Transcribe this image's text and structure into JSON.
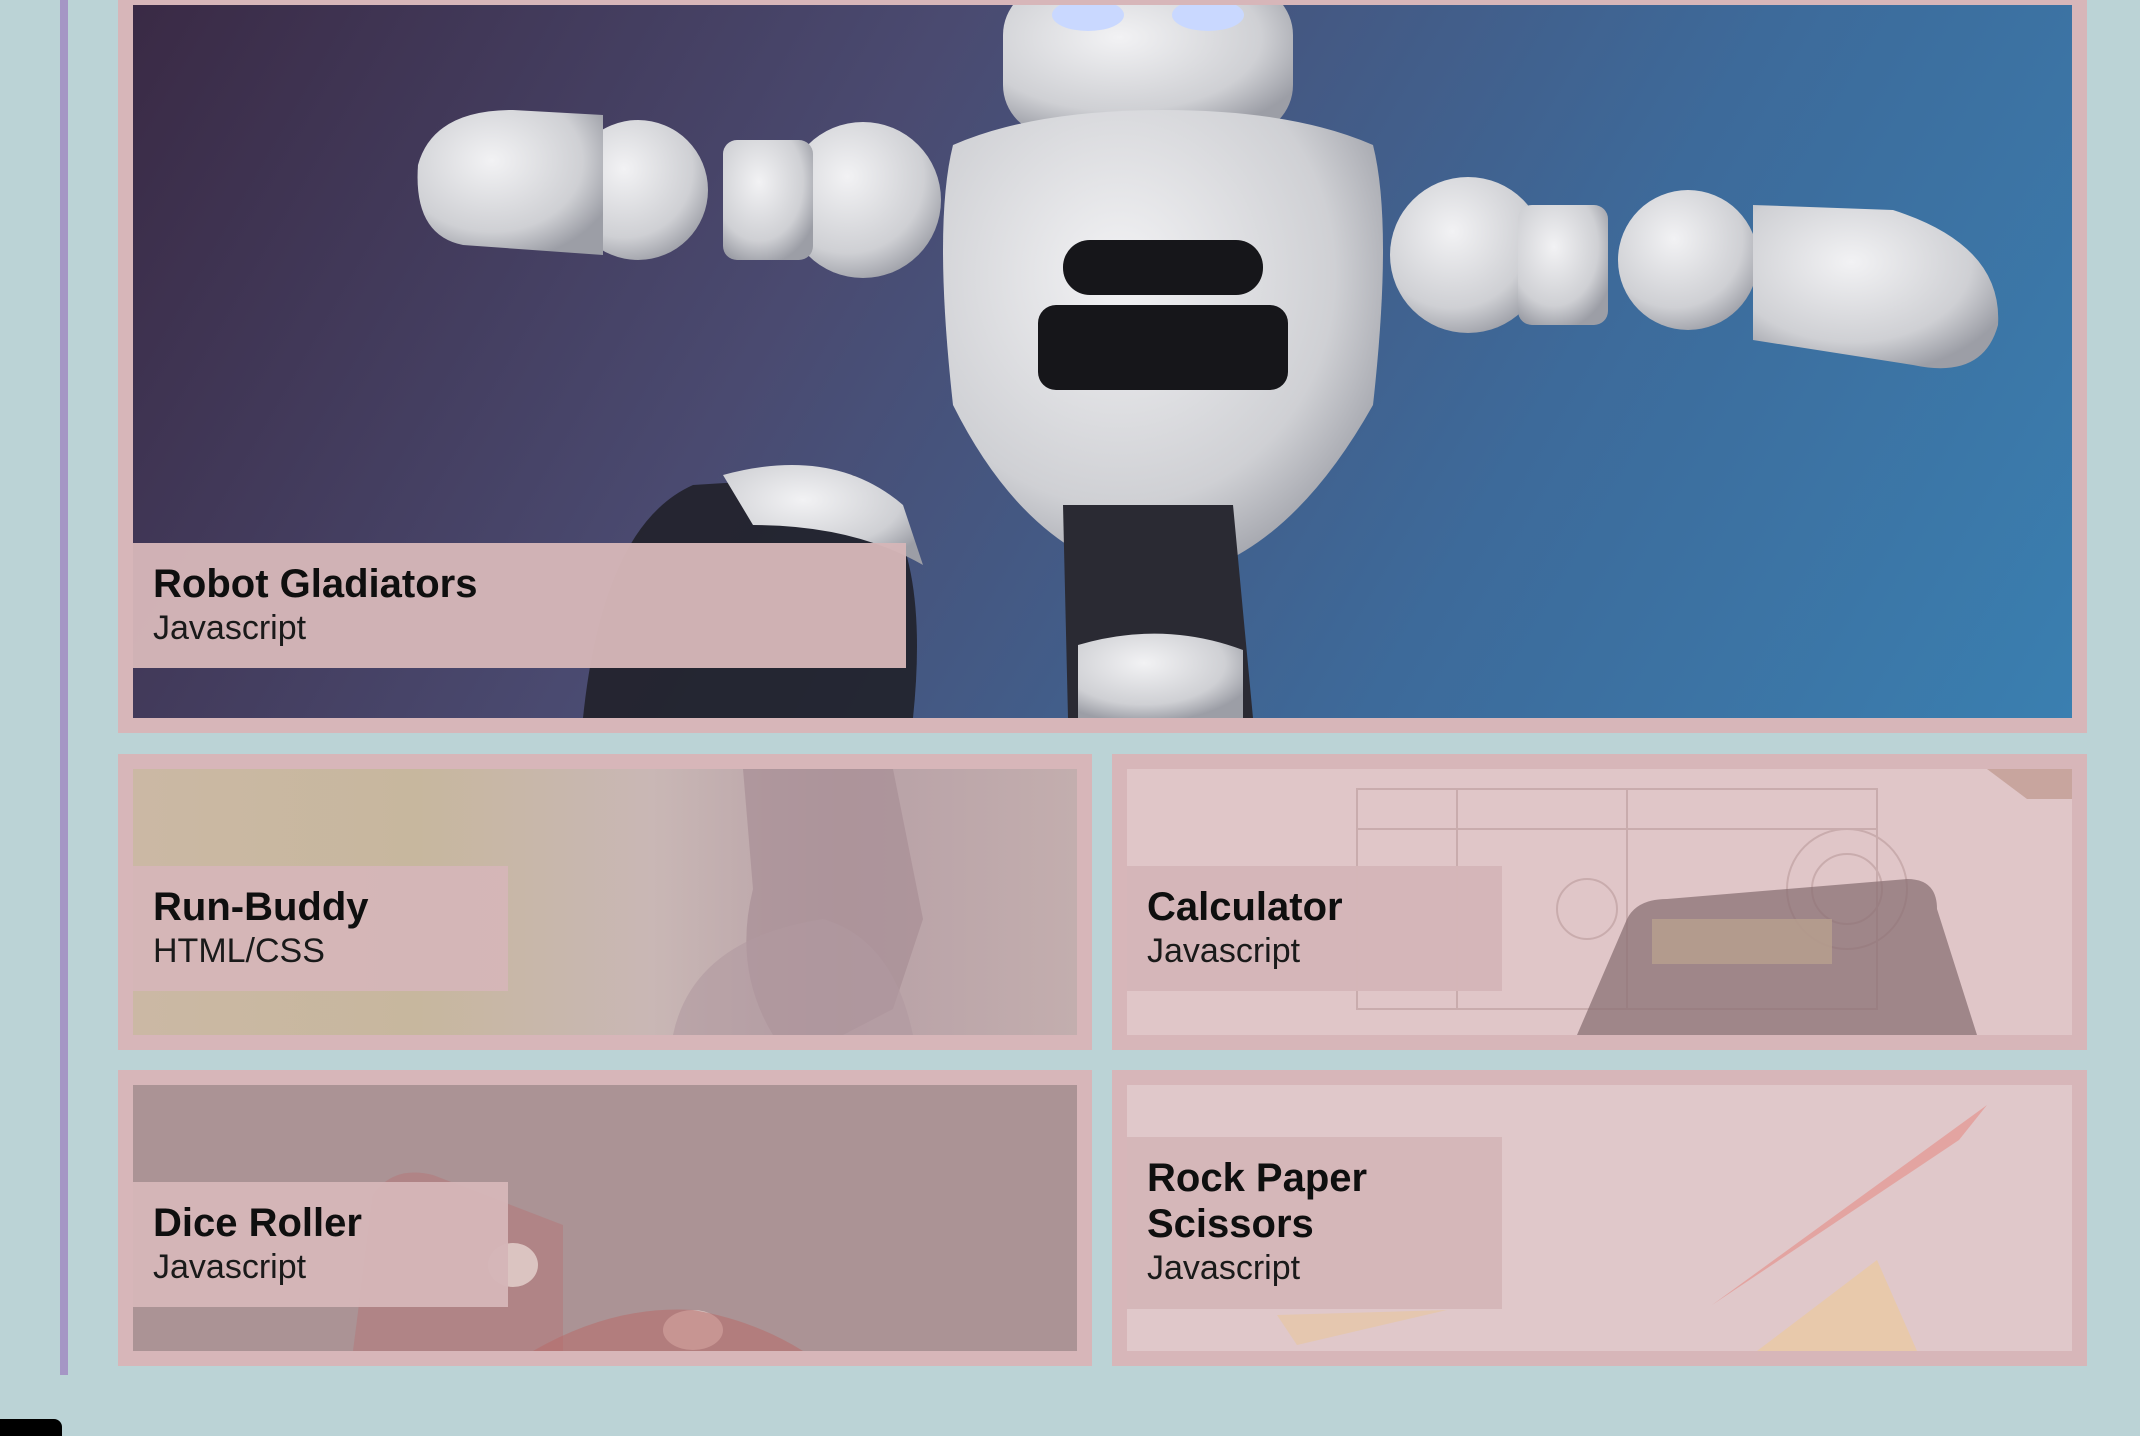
{
  "projects": [
    {
      "title": "Robot Gladiators",
      "language": "Javascript"
    },
    {
      "title": "Run-Buddy",
      "language": "HTML/CSS"
    },
    {
      "title": "Calculator",
      "language": "Javascript"
    },
    {
      "title": "Dice Roller",
      "language": "Javascript"
    },
    {
      "title": "Rock Paper Scissors",
      "language": "Javascript"
    }
  ],
  "colors": {
    "page_background": "#bbd3d6",
    "card_border": "#d7b6b9",
    "accent_line": "#a596c5"
  }
}
